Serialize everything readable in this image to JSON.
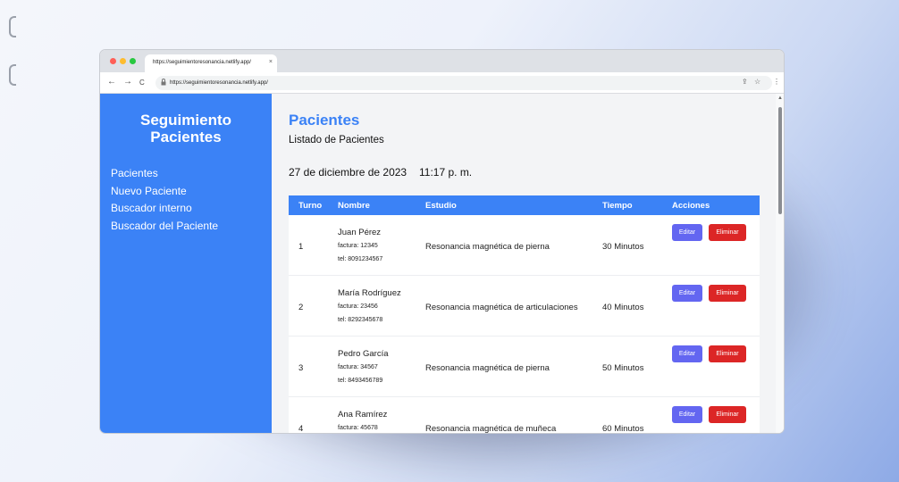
{
  "browser": {
    "tab_title": "https://seguimientoresonancia.netlify.app/",
    "tab_close": "×",
    "url": "https://seguimientoresonancia.netlify.app/"
  },
  "icons": {
    "back": "←",
    "forward": "→",
    "reload": "C",
    "lock": "🔒",
    "share": "⇪",
    "star": "☆",
    "menu": "⋮"
  },
  "colors": {
    "primary": "#3b82f6",
    "edit": "#6366f1",
    "delete": "#dc2626"
  },
  "sidebar": {
    "brand_line1": "Seguimiento",
    "brand_line2": "Pacientes",
    "items": [
      {
        "label": "Pacientes"
      },
      {
        "label": "Nuevo Paciente"
      },
      {
        "label": "Buscador interno"
      },
      {
        "label": "Buscador del Paciente"
      }
    ]
  },
  "main": {
    "title": "Pacientes",
    "subtitle": "Listado de Pacientes",
    "date": "27 de diciembre de 2023",
    "time": "11:17 p. m."
  },
  "table": {
    "headers": {
      "turno": "Turno",
      "nombre": "Nombre",
      "estudio": "Estudio",
      "tiempo": "Tiempo",
      "acciones": "Acciones"
    },
    "edit_label": "Editar",
    "delete_label": "Eliminar",
    "rows": [
      {
        "turno": "1",
        "nombre": "Juan Pérez",
        "factura": "factura: 12345",
        "tel": "tel: 8091234567",
        "estudio": "Resonancia magnética de pierna",
        "tiempo": "30 Minutos"
      },
      {
        "turno": "2",
        "nombre": "María Rodríguez",
        "factura": "factura: 23456",
        "tel": "tel: 8292345678",
        "estudio": "Resonancia magnética de articulaciones",
        "tiempo": "40 Minutos"
      },
      {
        "turno": "3",
        "nombre": "Pedro García",
        "factura": "factura: 34567",
        "tel": "tel: 8493456789",
        "estudio": "Resonancia magnética de pierna",
        "tiempo": "50 Minutos"
      },
      {
        "turno": "4",
        "nombre": "Ana Ramírez",
        "factura": "factura: 45678",
        "tel": "",
        "estudio": "Resonancia magnética de muñeca",
        "tiempo": "60 Minutos"
      }
    ]
  }
}
